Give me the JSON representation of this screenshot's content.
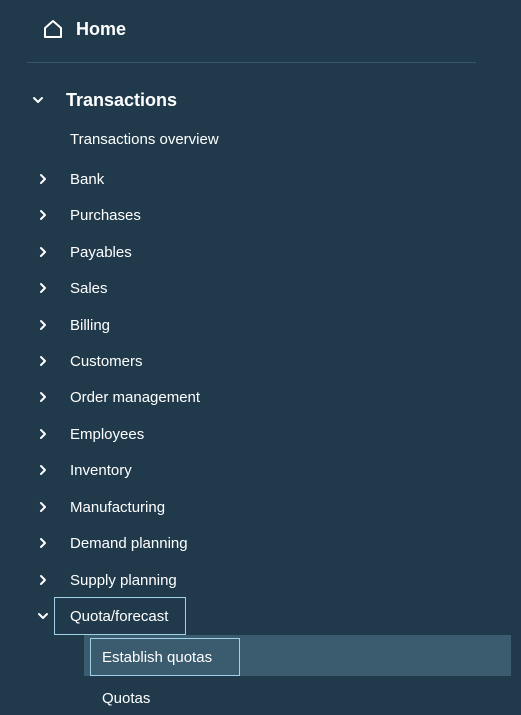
{
  "home": {
    "label": "Home",
    "icon": "home-icon"
  },
  "section": {
    "title": "Transactions",
    "expanded": true,
    "overview": "Transactions overview",
    "items": [
      {
        "label": "Bank",
        "expanded": false
      },
      {
        "label": "Purchases",
        "expanded": false
      },
      {
        "label": "Payables",
        "expanded": false
      },
      {
        "label": "Sales",
        "expanded": false
      },
      {
        "label": "Billing",
        "expanded": false
      },
      {
        "label": "Customers",
        "expanded": false
      },
      {
        "label": "Order management",
        "expanded": false
      },
      {
        "label": "Employees",
        "expanded": false
      },
      {
        "label": "Inventory",
        "expanded": false
      },
      {
        "label": "Manufacturing",
        "expanded": false
      },
      {
        "label": "Demand planning",
        "expanded": false
      },
      {
        "label": "Supply planning",
        "expanded": false
      },
      {
        "label": "Quota/forecast",
        "expanded": true
      }
    ],
    "quota_children": [
      {
        "label": "Establish quotas",
        "selected": true
      },
      {
        "label": "Quotas",
        "selected": false
      }
    ]
  },
  "colors": {
    "background": "#203a4c",
    "selected_background": "#3b5b6f",
    "focus_outline": "#9fd1e8",
    "divider": "#3b5668",
    "text": "#ffffff"
  }
}
